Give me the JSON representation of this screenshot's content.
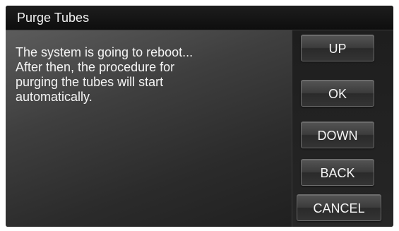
{
  "window": {
    "title": "Purge Tubes"
  },
  "message": {
    "lines": [
      "The system is going to reboot...",
      "After then, the procedure for",
      "purging the tubes will start",
      "automatically."
    ]
  },
  "buttons": {
    "up": "UP",
    "ok": "OK",
    "down": "DOWN",
    "back": "BACK",
    "cancel": "CANCEL"
  }
}
